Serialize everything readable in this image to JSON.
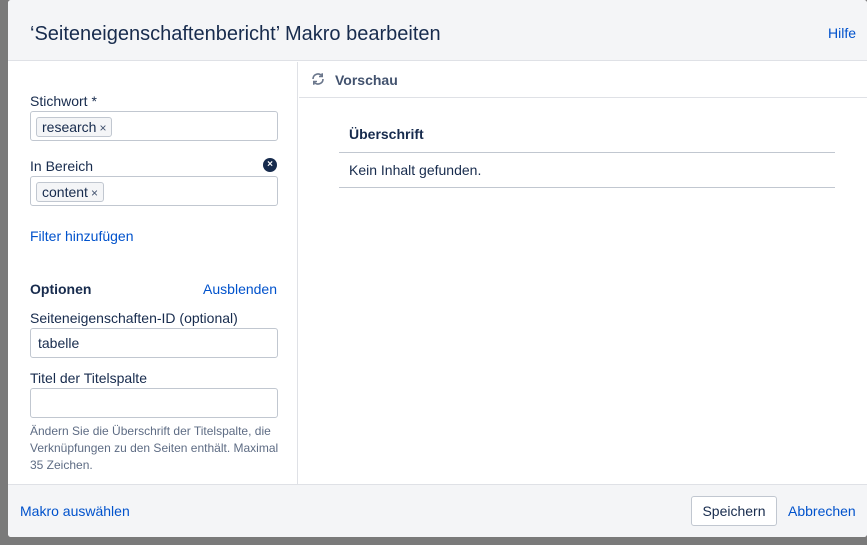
{
  "dialog": {
    "title": "‘Seiteneigenschaftenbericht’ Makro bearbeiten",
    "help_label": "Hilfe"
  },
  "left_panel": {
    "keyword_label": "Stichwort *",
    "keyword_tags": [
      "research"
    ],
    "space_label": "In Bereich",
    "space_tags": [
      "content"
    ],
    "tag_remove_glyph": "×",
    "clear_glyph": "×",
    "add_filter_label": "Filter hinzufügen",
    "options_heading": "Optionen",
    "hide_label": "Ausblenden",
    "page_props_id_label": "Seiteneigenschaften-ID (optional)",
    "page_props_id_value": "tabelle",
    "title_column_label": "Titel der Titelspalte",
    "title_column_value": "",
    "hint": "Ändern Sie die Überschrift der Titelspalte, die Verknüpfungen zu den Seiten enthält. Maximal 35 Zeichen."
  },
  "preview": {
    "label": "Vorschau",
    "table_header": "Überschrift",
    "table_row": "Kein Inhalt gefunden."
  },
  "footer": {
    "select_macro_label": "Makro auswählen",
    "save_label": "Speichern",
    "cancel_label": "Abbrechen"
  },
  "colors": {
    "link": "#0052cc",
    "text": "#172b4d",
    "backdrop": "#7a7a7a",
    "header_bg": "#f4f5f7"
  }
}
